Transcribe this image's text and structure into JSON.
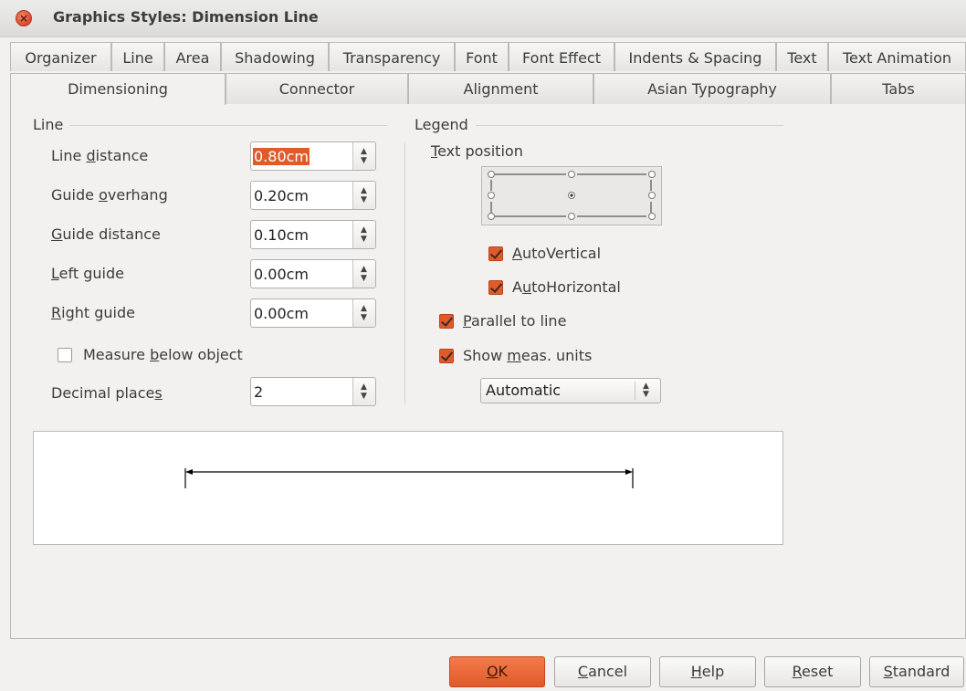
{
  "window": {
    "title": "Graphics Styles: Dimension Line"
  },
  "tabs_row1": [
    "Organizer",
    "Line",
    "Area",
    "Shadowing",
    "Transparency",
    "Font",
    "Font Effect",
    "Indents & Spacing",
    "Text",
    "Text Animation"
  ],
  "tabs_row2": [
    "Dimensioning",
    "Connector",
    "Alignment",
    "Asian Typography",
    "Tabs"
  ],
  "active_tab": "Dimensioning",
  "line_section": {
    "heading": "Line",
    "line_distance": {
      "pre": "Line ",
      "key": "d",
      "post": "istance",
      "value": "0.80cm"
    },
    "guide_overhang": {
      "pre": "Guide ",
      "key": "o",
      "post": "verhang",
      "value": "0.20cm"
    },
    "guide_distance": {
      "pre": "",
      "key": "G",
      "post": "uide distance",
      "value": "0.10cm"
    },
    "left_guide": {
      "pre": "",
      "key": "L",
      "post": "eft guide",
      "value": "0.00cm"
    },
    "right_guide": {
      "pre": "",
      "key": "R",
      "post": "ight guide",
      "value": "0.00cm"
    },
    "measure_below": {
      "pre": "Measure ",
      "key": "b",
      "post": "elow object",
      "checked": false
    },
    "decimal_places": {
      "pre": "Decimal place",
      "key": "s",
      "post": "",
      "value": "2"
    }
  },
  "legend_section": {
    "heading": "Legend",
    "text_position": {
      "pre": "",
      "key": "T",
      "post": "ext position"
    },
    "auto_vertical": {
      "pre": "",
      "key": "A",
      "post": "utoVertical",
      "checked": true
    },
    "auto_horizontal": {
      "pre": "A",
      "key": "u",
      "post": "toHorizontal",
      "checked": true
    },
    "parallel_to_line": {
      "pre": "",
      "key": "P",
      "post": "arallel to line",
      "checked": true
    },
    "show_units": {
      "pre": "Show ",
      "key": "m",
      "post": "eas. units",
      "checked": true
    },
    "units_select": "Automatic"
  },
  "buttons": {
    "ok": {
      "pre": "",
      "key": "O",
      "post": "K"
    },
    "cancel": {
      "pre": "",
      "key": "C",
      "post": "ancel"
    },
    "help": {
      "pre": "",
      "key": "H",
      "post": "elp"
    },
    "reset": {
      "pre": "",
      "key": "R",
      "post": "eset"
    },
    "standard": {
      "pre": "",
      "key": "S",
      "post": "tandard"
    }
  },
  "colors": {
    "accent": "#e05a2b",
    "background": "#f2f1f0"
  }
}
